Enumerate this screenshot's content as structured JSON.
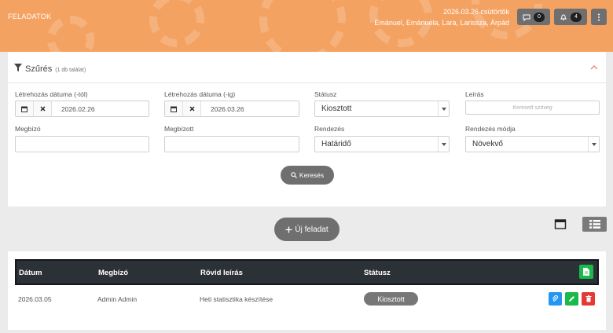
{
  "header": {
    "title": "FELADATOK",
    "date": "2026.03.26 csütörtök",
    "users": "Emánuel, Emánuéla, Lara, Larissza, Árpád",
    "messages_count": "0",
    "notifications_count": "4"
  },
  "filter": {
    "title": "Szűrés",
    "result_count": "(1 db találat)",
    "created_from": {
      "label": "Létrehozás dátuma (-tól)",
      "value": "2026.02.26"
    },
    "created_to": {
      "label": "Létrehozás dátuma (-ig)",
      "value": "2026.03.26"
    },
    "status": {
      "label": "Státusz",
      "value": "Kiosztott"
    },
    "description": {
      "label": "Leírás",
      "placeholder": "Keresett szöveg"
    },
    "client": {
      "label": "Megbízó",
      "value": ""
    },
    "assignee": {
      "label": "Megbízott",
      "value": ""
    },
    "sort": {
      "label": "Rendezés",
      "value": "Határidő"
    },
    "sort_mode": {
      "label": "Rendezés módja",
      "value": "Növekvő"
    },
    "search_button": "Keresés"
  },
  "new_task_button": "Új feladat",
  "table": {
    "headers": [
      "Dátum",
      "Megbízó",
      "Rövid leírás",
      "Státusz"
    ],
    "rows": [
      {
        "date": "2026.03.05",
        "client": "Admin Admin",
        "summary": "Heti statisztika készítése",
        "status": "Kiosztott"
      }
    ]
  },
  "colors": {
    "header_bg": "#f4a261",
    "button_gray": "#6f6f6f",
    "table_head": "#2c3137",
    "export_green": "#19b94a",
    "attach_blue": "#2196f3",
    "edit_green": "#19b94a",
    "delete_red": "#e53935"
  },
  "icons": [
    "filter-icon",
    "chevron-up-icon",
    "calendar-icon",
    "clear-icon",
    "caret-down-icon",
    "search-icon",
    "plus-icon",
    "card-view-icon",
    "list-view-icon",
    "chat-icon",
    "bell-icon",
    "more-vertical-icon",
    "export-icon",
    "paperclip-icon",
    "pencil-icon",
    "trash-icon"
  ]
}
